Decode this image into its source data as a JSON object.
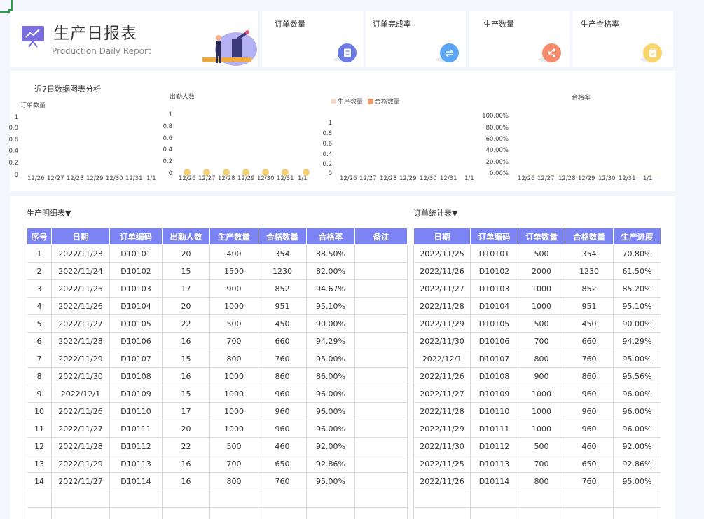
{
  "header": {
    "title": "生产日报表",
    "subtitle": "Production Daily Report"
  },
  "kpis": [
    {
      "label": "订单数量",
      "icon": "document-icon",
      "color": "#6d7be6"
    },
    {
      "label": "订单完成率",
      "icon": "exchange-icon",
      "color": "#5aa4f5"
    },
    {
      "label": "生产数量",
      "icon": "share-icon",
      "color": "#f58b6a"
    },
    {
      "label": "生产合格率",
      "icon": "clipboard-icon",
      "color": "#f7d56a"
    }
  ],
  "charts": {
    "section_title": "近7日数据图表分析",
    "legend": [
      "生产数量",
      "合格数量"
    ],
    "legend_colors": [
      "#f4d9cf",
      "#ef9a6d"
    ]
  },
  "chart_data": [
    {
      "type": "bar",
      "ylabel": "订单数量",
      "categories": [
        "12/26",
        "12/27",
        "12/28",
        "12/29",
        "12/30",
        "12/31",
        "1/1"
      ],
      "yticks": [
        "1",
        "0.8",
        "0.6",
        "0.4",
        "0.2",
        "0"
      ],
      "series": [
        {
          "values": [
            0,
            0,
            0,
            0,
            0,
            0,
            0
          ]
        }
      ],
      "ylim": [
        0,
        1
      ]
    },
    {
      "type": "scatter",
      "title": "出勤人数",
      "categories": [
        "12/26",
        "12/27",
        "12/28",
        "12/29",
        "12/30",
        "12/31",
        "1/1"
      ],
      "yticks": [
        "1",
        "0.8",
        "0.6",
        "0.4",
        "0.2",
        "0"
      ],
      "series": [
        {
          "values": [
            0,
            0,
            0,
            0,
            0,
            0,
            0
          ],
          "color": "#f1d27a"
        }
      ],
      "ylim": [
        0,
        1
      ]
    },
    {
      "type": "bar",
      "categories": [
        "12/26",
        "12/27",
        "12/28",
        "12/29",
        "12/30",
        "12/31",
        "1/1"
      ],
      "yticks": [
        "1",
        "0.8",
        "0.6",
        "0.4",
        "0.2",
        "0"
      ],
      "series": [
        {
          "name": "生产数量",
          "values": [
            0,
            0,
            0,
            0,
            0,
            0,
            0
          ]
        },
        {
          "name": "合格数量",
          "values": [
            0,
            0,
            0,
            0,
            0,
            0,
            0
          ]
        }
      ],
      "ylim": [
        0,
        1
      ]
    },
    {
      "type": "line",
      "title": "合格率",
      "categories": [
        "12/26",
        "12/27",
        "12/28",
        "12/29",
        "12/30",
        "12/31",
        "1/1"
      ],
      "yticks": [
        "100.00%",
        "80.00%",
        "60.00%",
        "40.00%",
        "20.00%",
        "0.00%"
      ],
      "series": [
        {
          "values": [
            0,
            0,
            0,
            0,
            0,
            0,
            0
          ],
          "color": "#e9e3b8"
        }
      ],
      "ylim": [
        0,
        1
      ]
    }
  ],
  "production_table": {
    "title": "生产明细表▼",
    "columns": [
      "序号",
      "日期",
      "订单编码",
      "出勤人数",
      "生产数量",
      "合格数量",
      "合格率",
      "备注"
    ],
    "rows": [
      [
        "1",
        "2022/11/23",
        "D10101",
        "20",
        "400",
        "354",
        "88.50%",
        ""
      ],
      [
        "2",
        "2022/11/24",
        "D10102",
        "15",
        "1500",
        "1230",
        "82.00%",
        ""
      ],
      [
        "3",
        "2022/11/25",
        "D10103",
        "17",
        "900",
        "852",
        "94.67%",
        ""
      ],
      [
        "4",
        "2022/11/26",
        "D10104",
        "20",
        "1000",
        "951",
        "95.10%",
        ""
      ],
      [
        "5",
        "2022/11/27",
        "D10105",
        "22",
        "500",
        "450",
        "90.00%",
        ""
      ],
      [
        "6",
        "2022/11/28",
        "D10106",
        "16",
        "700",
        "660",
        "94.29%",
        ""
      ],
      [
        "7",
        "2022/11/29",
        "D10107",
        "15",
        "800",
        "760",
        "95.00%",
        ""
      ],
      [
        "8",
        "2022/11/30",
        "D10108",
        "16",
        "1000",
        "860",
        "86.00%",
        ""
      ],
      [
        "9",
        "2022/12/1",
        "D10109",
        "15",
        "1000",
        "960",
        "96.00%",
        ""
      ],
      [
        "10",
        "2022/11/26",
        "D10110",
        "17",
        "1000",
        "960",
        "96.00%",
        ""
      ],
      [
        "11",
        "2022/11/27",
        "D10111",
        "20",
        "1000",
        "960",
        "96.00%",
        ""
      ],
      [
        "12",
        "2022/11/28",
        "D10112",
        "22",
        "500",
        "460",
        "92.00%",
        ""
      ],
      [
        "13",
        "2022/11/29",
        "D10113",
        "16",
        "700",
        "650",
        "92.86%",
        ""
      ],
      [
        "14",
        "2022/11/27",
        "D10114",
        "16",
        "800",
        "760",
        "95.00%",
        ""
      ],
      [
        "",
        "",
        "",
        "",
        "",
        "",
        "",
        ""
      ],
      [
        "",
        "",
        "",
        "",
        "",
        "",
        "",
        ""
      ]
    ]
  },
  "order_table": {
    "title": "订单统计表▼",
    "columns": [
      "日期",
      "订单编码",
      "订单数量",
      "合格数量",
      "生产进度"
    ],
    "rows": [
      [
        "2022/11/25",
        "D10101",
        "500",
        "354",
        "70.80%"
      ],
      [
        "2022/11/26",
        "D10102",
        "2000",
        "1230",
        "61.50%"
      ],
      [
        "2022/11/27",
        "D10103",
        "1000",
        "852",
        "85.20%"
      ],
      [
        "2022/11/28",
        "D10104",
        "1000",
        "951",
        "95.10%"
      ],
      [
        "2022/11/29",
        "D10105",
        "500",
        "450",
        "90.00%"
      ],
      [
        "2022/11/30",
        "D10106",
        "700",
        "660",
        "94.29%"
      ],
      [
        "2022/12/1",
        "D10107",
        "800",
        "760",
        "95.00%"
      ],
      [
        "2022/11/26",
        "D10108",
        "900",
        "860",
        "95.56%"
      ],
      [
        "2022/11/27",
        "D10109",
        "1000",
        "960",
        "96.00%"
      ],
      [
        "2022/11/28",
        "D10110",
        "1000",
        "960",
        "96.00%"
      ],
      [
        "2022/11/29",
        "D10111",
        "1000",
        "960",
        "96.00%"
      ],
      [
        "2022/11/30",
        "D10112",
        "500",
        "460",
        "92.00%"
      ],
      [
        "2022/11/25",
        "D10113",
        "700",
        "650",
        "92.86%"
      ],
      [
        "2022/11/26",
        "D10114",
        "800",
        "760",
        "95.00%"
      ],
      [
        "",
        "",
        "",
        "",
        ""
      ],
      [
        "",
        "",
        "",
        "",
        ""
      ]
    ]
  }
}
